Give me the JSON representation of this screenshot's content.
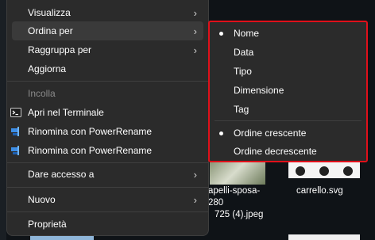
{
  "menu": {
    "items": {
      "visualizza": "Visualizza",
      "ordina_per": "Ordina per",
      "raggruppa_per": "Raggruppa per",
      "aggiorna": "Aggiorna",
      "incolla": "Incolla",
      "apri_terminale": "Apri nel Terminale",
      "rinomina_1": "Rinomina con PowerRename",
      "rinomina_2": "Rinomina con PowerRename",
      "dare_accesso": "Dare accesso a",
      "nuovo": "Nuovo",
      "proprieta": "Proprietà"
    },
    "chevron": "›"
  },
  "submenu": {
    "items": {
      "nome": "Nome",
      "data": "Data",
      "tipo": "Tipo",
      "dimensione": "Dimensione",
      "tag": "Tag",
      "ordine_crescente": "Ordine crescente",
      "ordine_decrescente": "Ordine decrescente"
    },
    "selected": [
      "Nome",
      "Ordine crescente"
    ]
  },
  "desktop": {
    "file_1_line1": "apelli-sposa-280",
    "file_1_line2": "725 (4).jpeg",
    "file_2": "carrello.svg"
  },
  "icons": [
    "terminal-icon",
    "powerrename-icon",
    "chevron-right-icon",
    "bullet-icon"
  ],
  "colors": {
    "menu_bg": "#2b2b2b",
    "highlight_border": "#e0101a",
    "hover_bg": "#3a3a3a"
  }
}
